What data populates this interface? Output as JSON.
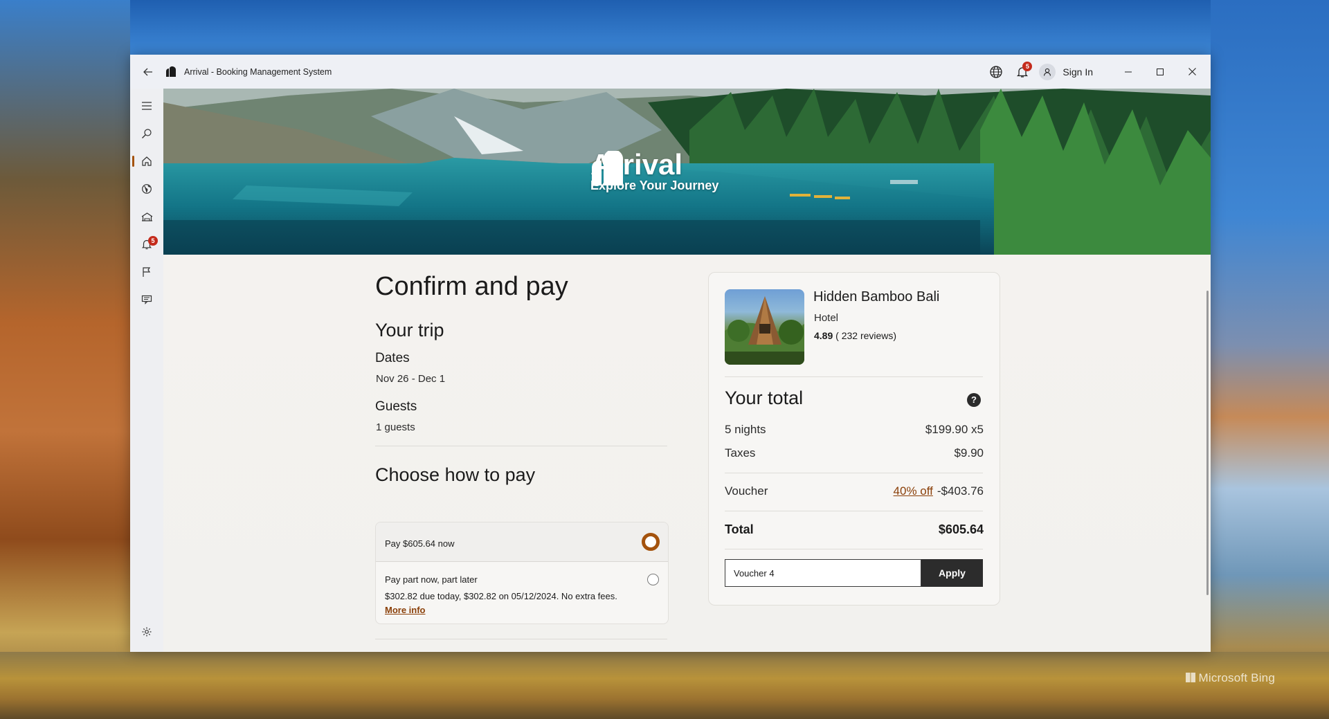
{
  "window": {
    "title": "Arrival - Booking Management System",
    "notification_count": "5",
    "sign_in_label": "Sign In"
  },
  "sidebar": {
    "items": [
      {
        "icon": "hamburger-icon"
      },
      {
        "icon": "search-icon"
      },
      {
        "icon": "home-icon",
        "selected": true
      },
      {
        "icon": "globe-icon"
      },
      {
        "icon": "hotel-icon"
      },
      {
        "icon": "bell-icon",
        "badge": "5"
      },
      {
        "icon": "flag-icon"
      },
      {
        "icon": "chat-icon"
      },
      {
        "icon": "gear-icon"
      }
    ]
  },
  "hero": {
    "brand_name": "Arrival",
    "tagline": "Explore Your Journey"
  },
  "checkout": {
    "heading": "Confirm and pay",
    "trip_heading": "Your trip",
    "dates_label": "Dates",
    "dates_value": "Nov 26 - Dec 1",
    "guests_label": "Guests",
    "guests_value": "1  guests",
    "pay_heading": "Choose how to pay",
    "pay_options": [
      {
        "label": "Pay $605.64 now",
        "selected": true
      },
      {
        "label": "Pay part now, part later",
        "detail": "$302.82 due today, $302.82 on 05/12/2024. No extra fees.",
        "link": "More info",
        "selected": false
      }
    ]
  },
  "summary": {
    "hotel_name": "Hidden Bamboo Bali",
    "hotel_type": "Hotel",
    "rating": "4.89",
    "reviews": "( 232 reviews)",
    "total_heading": "Your total",
    "help_icon": "?",
    "nights_label": "5 nights",
    "nights_value": "$199.90 x5",
    "taxes_label": "Taxes",
    "taxes_value": "$9.90",
    "voucher_label": "Voucher",
    "voucher_discount": "40% off",
    "voucher_value": "-$403.76",
    "total_label": "Total",
    "total_value": "$605.64",
    "voucher_input_value": "Voucher 4",
    "apply_label": "Apply"
  },
  "desktop": {
    "watermark": "Microsoft Bing"
  },
  "colors": {
    "accent": "#a4530e",
    "badge": "#c42b1c",
    "button_dark": "#2c2c2c"
  }
}
